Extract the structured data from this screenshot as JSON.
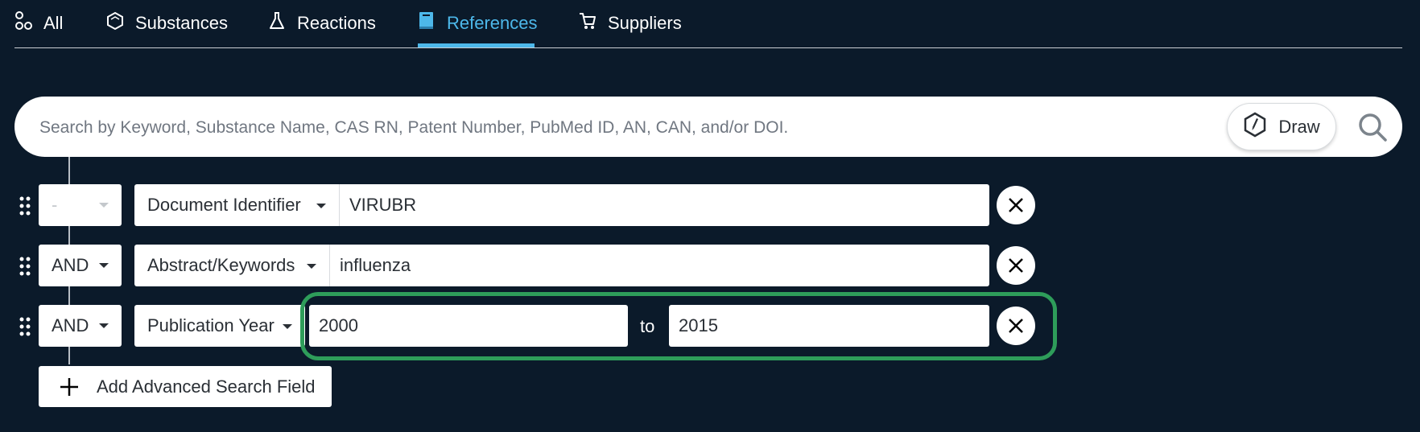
{
  "tabs": [
    {
      "label": "All",
      "icon": "molecule-icon",
      "active": false
    },
    {
      "label": "Substances",
      "icon": "hexagon-icon",
      "active": false
    },
    {
      "label": "Reactions",
      "icon": "flask-icon",
      "active": false
    },
    {
      "label": "References",
      "icon": "book-icon",
      "active": true
    },
    {
      "label": "Suppliers",
      "icon": "cart-icon",
      "active": false
    }
  ],
  "colors": {
    "background": "#0b1a2a",
    "accent": "#4db8ea",
    "highlight": "#2e9d5a"
  },
  "search": {
    "placeholder": "Search by Keyword, Substance Name, CAS RN, Patent Number, PubMed ID, AN, CAN, and/or DOI.",
    "draw_label": "Draw",
    "search_icon": "magnifier-icon"
  },
  "rows": [
    {
      "operator": "-",
      "field": "Document Identifier",
      "value": "VIRUBR"
    },
    {
      "operator": "AND",
      "field": "Abstract/Keywords",
      "value": "influenza"
    },
    {
      "operator": "AND",
      "field": "Publication Year",
      "from": "2000",
      "to_label": "to",
      "to": "2015"
    }
  ],
  "add_field_label": "Add Advanced Search Field"
}
